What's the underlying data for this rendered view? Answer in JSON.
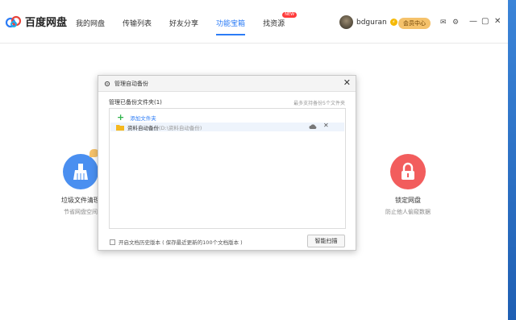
{
  "app": {
    "logo_text": "百度网盘",
    "brand_color": "#2c7cf6"
  },
  "nav": {
    "tabs": [
      {
        "label": "我的网盘"
      },
      {
        "label": "传输列表"
      },
      {
        "label": "好友分享"
      },
      {
        "label": "功能宝箱",
        "active": true
      },
      {
        "label": "找资源",
        "badge": "NEW"
      }
    ]
  },
  "user": {
    "name": "bdguran",
    "member_label": "会员中心"
  },
  "tools": {
    "left": {
      "name": "垃圾文件清理",
      "desc": "节省网盘空间",
      "color": "#4a8ff0"
    },
    "right": {
      "name": "锁定网盘",
      "desc": "防止他人偷窥数据",
      "color": "#f25d5d"
    }
  },
  "dialog": {
    "title": "管理自动备份",
    "section_title": "管理已备份文件夹(1)",
    "section_hint": "最多支持备份5个文件夹",
    "add_label": "添加文件夹",
    "folders": [
      {
        "name": "资料自动备份",
        "path": "(D:\\资料自动备份)"
      }
    ],
    "history_label": "开启文档历史版本 ( 保存最近更新的100个文档版本 )",
    "history_checked": false,
    "scan_button": "智能扫描"
  }
}
